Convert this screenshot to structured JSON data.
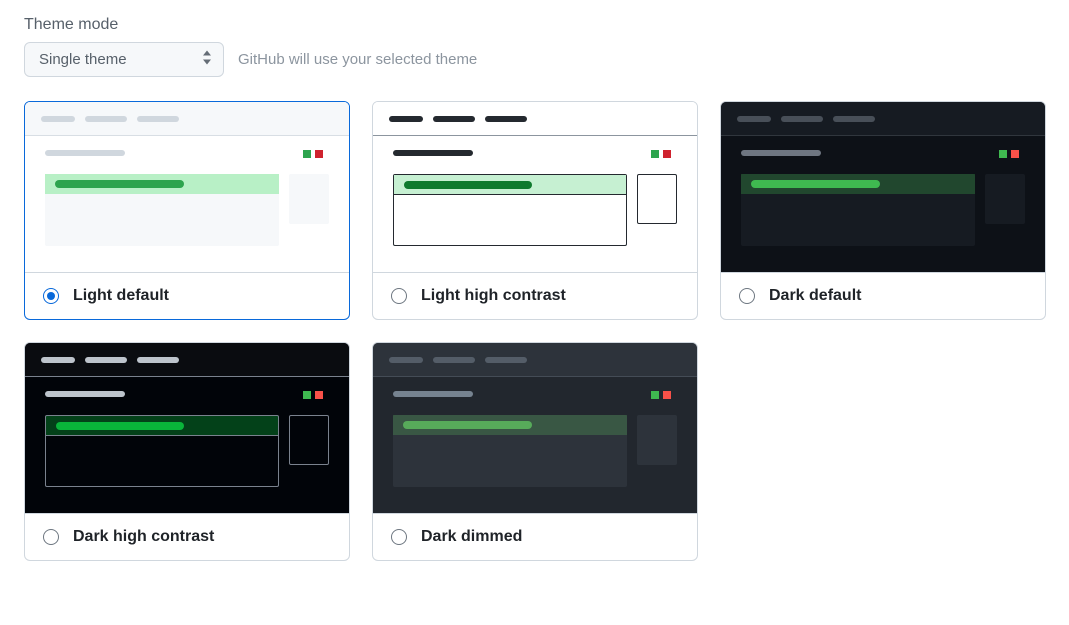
{
  "section_title": "Theme mode",
  "mode_select": {
    "selected": "Single theme",
    "options": [
      "Single theme"
    ]
  },
  "helper_text": "GitHub will use your selected theme",
  "themes": [
    {
      "id": "light-default",
      "label": "Light default",
      "selected": true,
      "class": "light-default"
    },
    {
      "id": "light-hc",
      "label": "Light high contrast",
      "selected": false,
      "class": "light-hc"
    },
    {
      "id": "dark-default",
      "label": "Dark default",
      "selected": false,
      "class": "dark-default"
    },
    {
      "id": "dark-hc",
      "label": "Dark high contrast",
      "selected": false,
      "class": "dark-hc"
    },
    {
      "id": "dark-dimmed",
      "label": "Dark dimmed",
      "selected": false,
      "class": "dark-dimmed"
    }
  ]
}
